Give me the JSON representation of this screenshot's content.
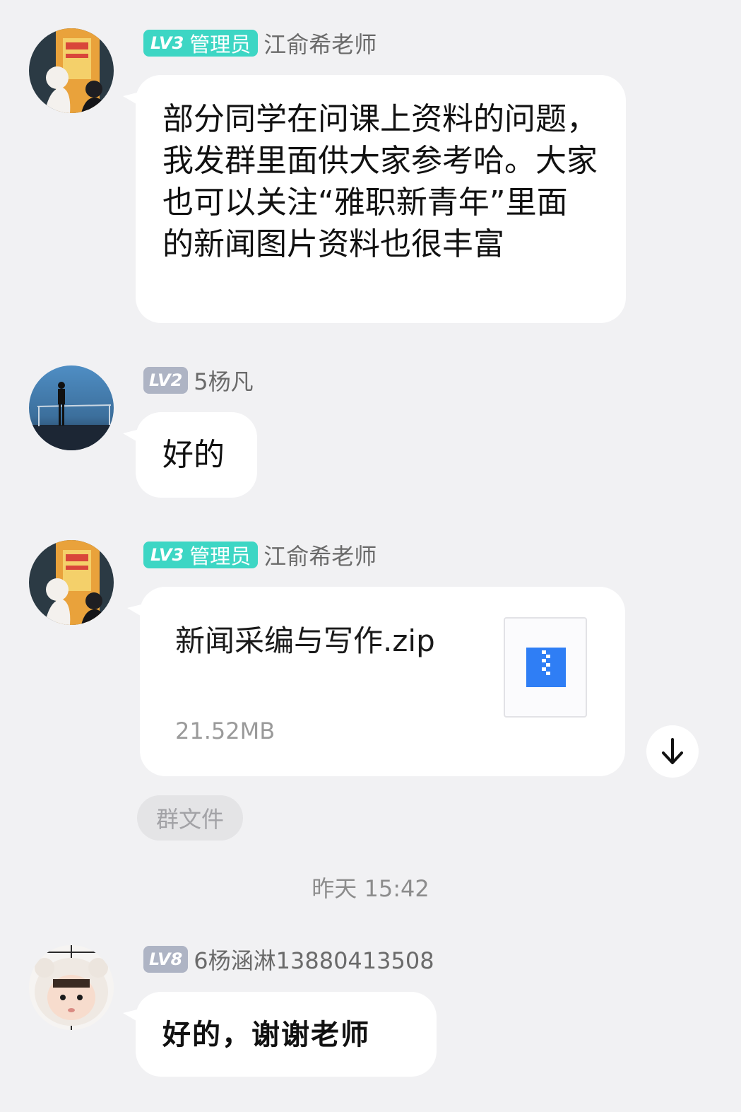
{
  "colors": {
    "background": "#f1f1f3",
    "bubble": "#ffffff",
    "admin_badge": "#3dd6c4",
    "level_badge": "#aeb4c4",
    "file_icon": "#2f7ef5"
  },
  "messages": [
    {
      "avatar": "teacher-photo-avatar",
      "level": "LV3",
      "role": "管理员",
      "sender": "江俞希老师",
      "text": "部分同学在问课上资料的问题，我发群里面供大家参考哈。大家也可以关注“雅职新青年”里面的新闻图片资料也很丰富"
    },
    {
      "avatar": "silhouette-photo-avatar",
      "level": "LV2",
      "sender": "5杨凡",
      "text": "好的"
    },
    {
      "avatar": "teacher-photo-avatar",
      "level": "LV3",
      "role": "管理员",
      "sender": "江俞希老师",
      "file": {
        "name": "新闻采编与写作.zip",
        "size": "21.52MB",
        "icon": "zip-file-icon"
      },
      "download_icon": "download-arrow-icon",
      "tag": "群文件"
    },
    {
      "avatar": "baby-photo-avatar",
      "level": "LV8",
      "sender": "6杨涵淋13880413508",
      "text": "好的，谢谢老师"
    }
  ],
  "timestamp": "昨天 15:42"
}
